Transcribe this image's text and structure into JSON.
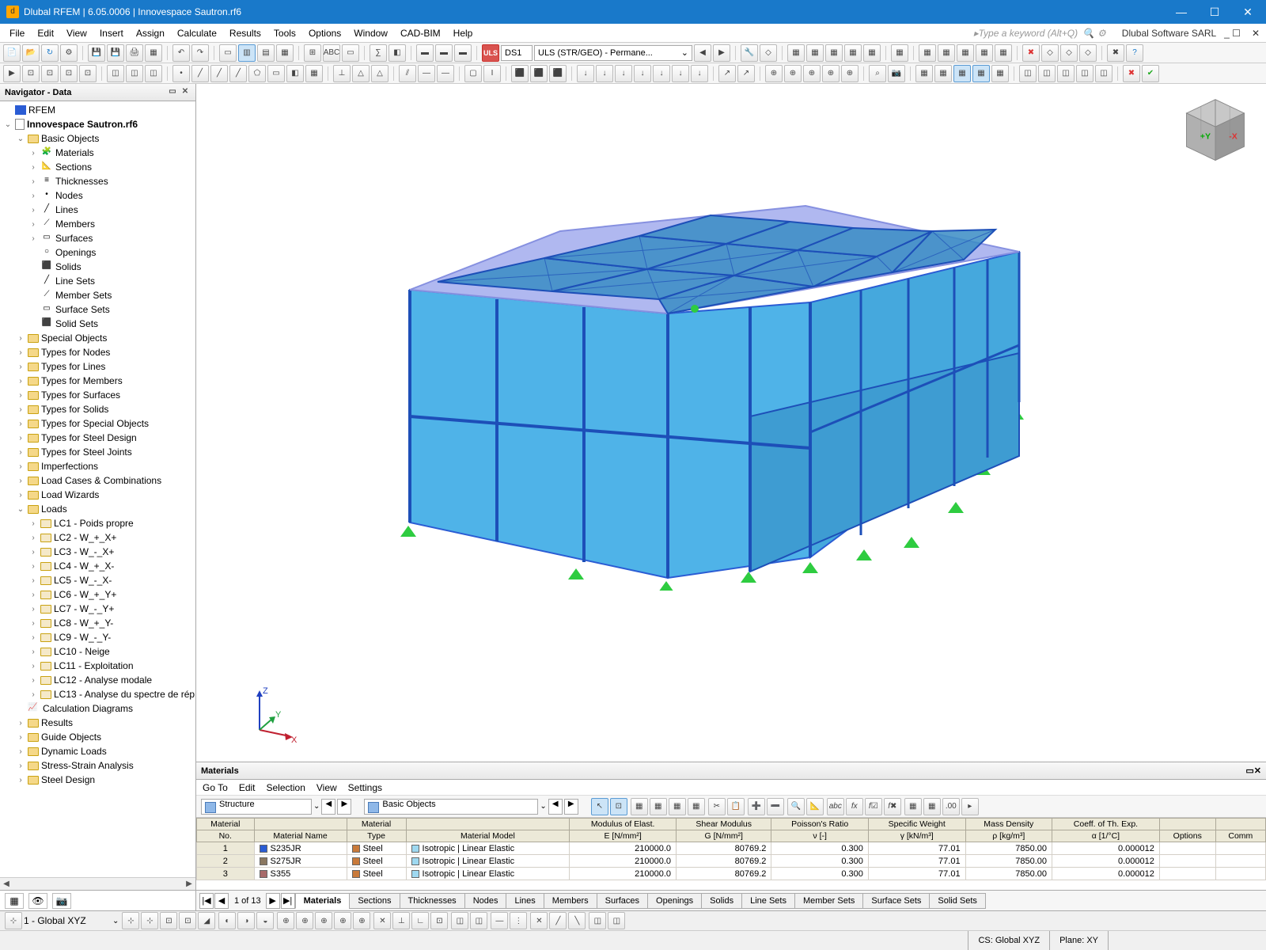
{
  "titlebar": {
    "app_icon": "d",
    "title": "Dlubal RFEM | 6.05.0006 | Innovespace Sautron.rf6"
  },
  "menubar": {
    "items": [
      "File",
      "Edit",
      "View",
      "Insert",
      "Assign",
      "Calculate",
      "Results",
      "Tools",
      "Options",
      "Window",
      "CAD-BIM",
      "Help"
    ],
    "search_placeholder": "Type a keyword (Alt+Q)",
    "company": "Dlubal Software SARL"
  },
  "toolbar1": {
    "uls_badge": "ULS",
    "ds_label": "DS1",
    "analysis_combo": "ULS (STR/GEO) - Permane..."
  },
  "navigator": {
    "title": "Navigator - Data",
    "root": "RFEM",
    "file": "Innovespace Sautron.rf6",
    "basic_objects": {
      "label": "Basic Objects",
      "items": [
        "Materials",
        "Sections",
        "Thicknesses",
        "Nodes",
        "Lines",
        "Members",
        "Surfaces",
        "Openings",
        "Solids",
        "Line Sets",
        "Member Sets",
        "Surface Sets",
        "Solid Sets"
      ]
    },
    "folders": [
      "Special Objects",
      "Types for Nodes",
      "Types for Lines",
      "Types for Members",
      "Types for Surfaces",
      "Types for Solids",
      "Types for Special Objects",
      "Types for Steel Design",
      "Types for Steel Joints",
      "Imperfections",
      "Load Cases & Combinations",
      "Load Wizards"
    ],
    "loads": {
      "label": "Loads",
      "items": [
        "LC1 - Poids propre",
        "LC2 - W_+_X+",
        "LC3 - W_-_X+",
        "LC4 - W_+_X-",
        "LC5 - W_-_X-",
        "LC6 - W_+_Y+",
        "LC7 - W_-_Y+",
        "LC8 - W_+_Y-",
        "LC9 - W_-_Y-",
        "LC10 - Neige",
        "LC11 - Exploitation",
        "LC12 - Analyse modale",
        "LC13 - Analyse du spectre de rép"
      ]
    },
    "lower": [
      "Calculation Diagrams",
      "Results",
      "Guide Objects",
      "Dynamic Loads",
      "Stress-Strain Analysis",
      "Steel Design"
    ]
  },
  "materials_panel": {
    "title": "Materials",
    "menu": [
      "Go To",
      "Edit",
      "Selection",
      "View",
      "Settings"
    ],
    "combo1": "Structure",
    "combo2": "Basic Objects",
    "columns_top": [
      "Material",
      "",
      "Material",
      "",
      "Modulus of Elast.",
      "Shear Modulus",
      "Poisson's Ratio",
      "Specific Weight",
      "Mass Density",
      "Coeff. of Th. Exp.",
      "",
      ""
    ],
    "columns_bot": [
      "No.",
      "Material Name",
      "Type",
      "Material Model",
      "E [N/mm²]",
      "G [N/mm²]",
      "ν [-]",
      "γ [kN/m³]",
      "ρ [kg/m³]",
      "α [1/°C]",
      "Options",
      "Comm"
    ],
    "rows": [
      {
        "no": "1",
        "name": "S235JR",
        "swatch": "#2a5cd4",
        "type_swatch": "#c97a3a",
        "type": "Steel",
        "model": "Isotropic | Linear Elastic",
        "E": "210000.0",
        "G": "80769.2",
        "nu": "0.300",
        "gamma": "77.01",
        "rho": "7850.00",
        "alpha": "0.000012"
      },
      {
        "no": "2",
        "name": "S275JR",
        "swatch": "#8a7760",
        "type_swatch": "#c97a3a",
        "type": "Steel",
        "model": "Isotropic | Linear Elastic",
        "E": "210000.0",
        "G": "80769.2",
        "nu": "0.300",
        "gamma": "77.01",
        "rho": "7850.00",
        "alpha": "0.000012"
      },
      {
        "no": "3",
        "name": "S355",
        "swatch": "#a86a6a",
        "type_swatch": "#c97a3a",
        "type": "Steel",
        "model": "Isotropic | Linear Elastic",
        "E": "210000.0",
        "G": "80769.2",
        "nu": "0.300",
        "gamma": "77.01",
        "rho": "7850.00",
        "alpha": "0.000012"
      }
    ],
    "pager": "1 of 13",
    "tabs": [
      "Materials",
      "Sections",
      "Thicknesses",
      "Nodes",
      "Lines",
      "Members",
      "Surfaces",
      "Openings",
      "Solids",
      "Line Sets",
      "Member Sets",
      "Surface Sets",
      "Solid Sets"
    ]
  },
  "statusbar": {
    "cs_combo": "1 - Global XYZ",
    "cs_label": "CS: Global XYZ",
    "plane_label": "Plane: XY"
  }
}
